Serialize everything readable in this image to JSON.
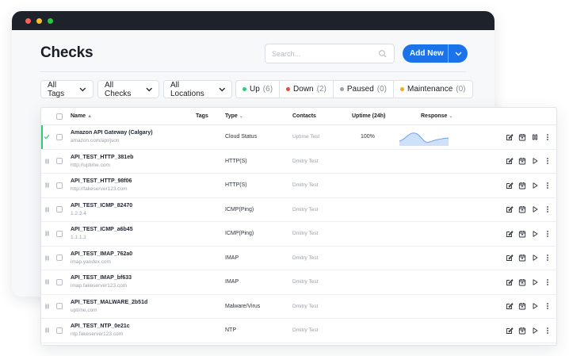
{
  "window": {
    "controls": [
      {
        "name": "close",
        "color": "#ff5f57"
      },
      {
        "name": "minimize",
        "color": "#febc2e"
      },
      {
        "name": "maximize",
        "color": "#28c840"
      }
    ]
  },
  "header": {
    "title": "Checks",
    "search_placeholder": "Search...",
    "add_new_label": "Add New"
  },
  "filters": {
    "tags": "All Tags",
    "checks": "All Checks",
    "locations": "All Locations",
    "statuses": [
      {
        "label": "Up",
        "count": "(6)",
        "color": "#2ecc71"
      },
      {
        "label": "Down",
        "count": "(2)",
        "color": "#e74c3c"
      },
      {
        "label": "Paused",
        "count": "(0)",
        "color": "#9aa0a8"
      },
      {
        "label": "Maintenance",
        "count": "(0)",
        "color": "#f5a623"
      }
    ]
  },
  "table": {
    "headers": {
      "name": "Name",
      "tags": "Tags",
      "type": "Type",
      "contacts": "Contacts",
      "uptime": "Uptime (24h)",
      "response": "Response"
    },
    "rows": [
      {
        "name": "Amazon API Gateway (Calgary)",
        "url": "amazon.com/api/json",
        "type": "Cloud Status",
        "contacts": "Uptime Test",
        "uptime": "100%",
        "state": "up"
      },
      {
        "name": "API_TEST_HTTP_381eb",
        "url": "http://uptime.com",
        "type": "HTTP(S)",
        "contacts": "Dmitry Test",
        "uptime": "",
        "state": "paused"
      },
      {
        "name": "API_TEST_HTTP_98f06",
        "url": "http://fakeserver123.com",
        "type": "HTTP(S)",
        "contacts": "Dmitry Test",
        "uptime": "",
        "state": "paused"
      },
      {
        "name": "API_TEST_ICMP_82470",
        "url": "1.2.3.4",
        "type": "ICMP(Ping)",
        "contacts": "Dmitry Test",
        "uptime": "",
        "state": "paused"
      },
      {
        "name": "API_TEST_ICMP_a6b45",
        "url": "1.1.1.1",
        "type": "ICMP(Ping)",
        "contacts": "Dmitry Test",
        "uptime": "",
        "state": "paused"
      },
      {
        "name": "API_TEST_IMAP_762a0",
        "url": "imap.yandex.com",
        "type": "IMAP",
        "contacts": "Dmitry Test",
        "uptime": "",
        "state": "paused"
      },
      {
        "name": "API_TEST_IMAP_bf633",
        "url": "imap.fakeserver123.com",
        "type": "IMAP",
        "contacts": "Dmitry Test",
        "uptime": "",
        "state": "paused"
      },
      {
        "name": "API_TEST_MALWARE_2b51d",
        "url": "uptime.com",
        "type": "Malware/Virus",
        "contacts": "Dmitry Test",
        "uptime": "",
        "state": "paused"
      },
      {
        "name": "API_TEST_NTP_0e21c",
        "url": "ntp.fakeserver123.com",
        "type": "NTP",
        "contacts": "Dmitry Test",
        "uptime": "",
        "state": "paused"
      }
    ]
  },
  "colors": {
    "accent": "#1a73e8",
    "titlebar": "#1e222a",
    "up": "#2ecc71"
  }
}
